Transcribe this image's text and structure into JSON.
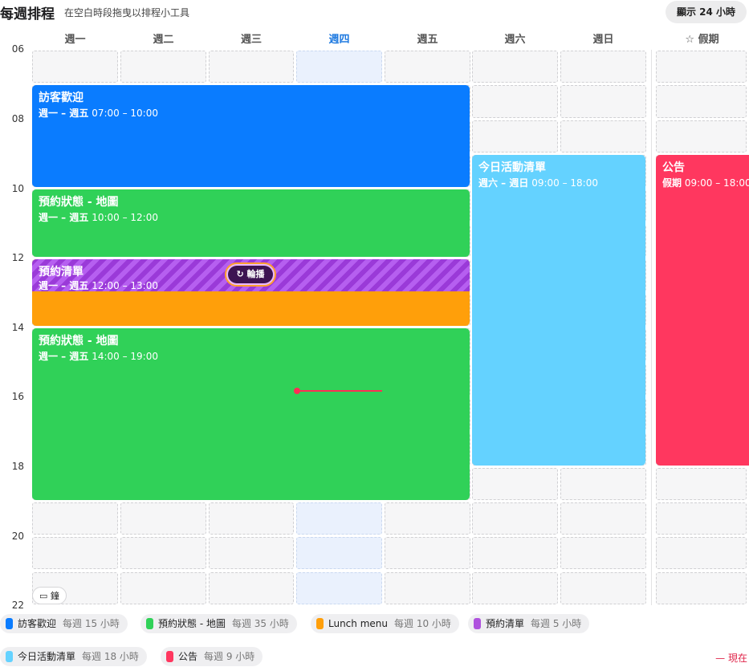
{
  "header": {
    "title": "每週排程",
    "subtitle": "在空白時段拖曳以排程小工具",
    "show_all_button": "顯示 24 小時"
  },
  "days": [
    "週一",
    "週二",
    "週三",
    "週四",
    "週五",
    "週六",
    "週日",
    "☆ 假期"
  ],
  "today_index": 3,
  "hours": [
    "06",
    "08",
    "10",
    "12",
    "14",
    "16",
    "18",
    "20",
    "22"
  ],
  "events": {
    "visitor": {
      "title": "訪客歡迎",
      "days": "週一 – 週五",
      "time": "07:00 – 10:00",
      "color": "#0a7cff"
    },
    "booking1": {
      "title": "預約狀態 - 地圖",
      "days": "週一 – 週五",
      "time": "10:00 – 12:00",
      "color": "#30d158"
    },
    "list": {
      "title": "預約清單",
      "days": "週一 – 週五",
      "time": "12:00 – 13:00",
      "color": "#af52de"
    },
    "booking2": {
      "title": "預約狀態 - 地圖",
      "days": "週一 – 週五",
      "time": "14:00 – 19:00",
      "color": "#30d158"
    },
    "today_list": {
      "title": "今日活動清單",
      "days": "週六 – 週日",
      "time": "09:00 – 18:00",
      "color": "#64d2ff"
    },
    "notice": {
      "title": "公告",
      "days": "假期",
      "time": "09:00 – 18:00",
      "color": "#ff375f"
    },
    "lunch": {
      "color": "#ff9f0a"
    }
  },
  "rotate_button": "輪播",
  "clock_button": "鐘",
  "legend": [
    {
      "name": "訪客歡迎",
      "hours": "每週 15 小時",
      "color": "#0a7cff"
    },
    {
      "name": "預約狀態 - 地圖",
      "hours": "每週 35 小時",
      "color": "#30d158"
    },
    {
      "name": "Lunch menu",
      "hours": "每週 10 小時",
      "color": "#ff9f0a"
    },
    {
      "name": "預約清單",
      "hours": "每週 5 小時",
      "color": "#af52de"
    },
    {
      "name": "今日活動清單",
      "hours": "每週 18 小時",
      "color": "#64d2ff"
    },
    {
      "name": "公告",
      "hours": "每週 9 小時",
      "color": "#ff375f"
    }
  ],
  "now_label": "— 現在"
}
